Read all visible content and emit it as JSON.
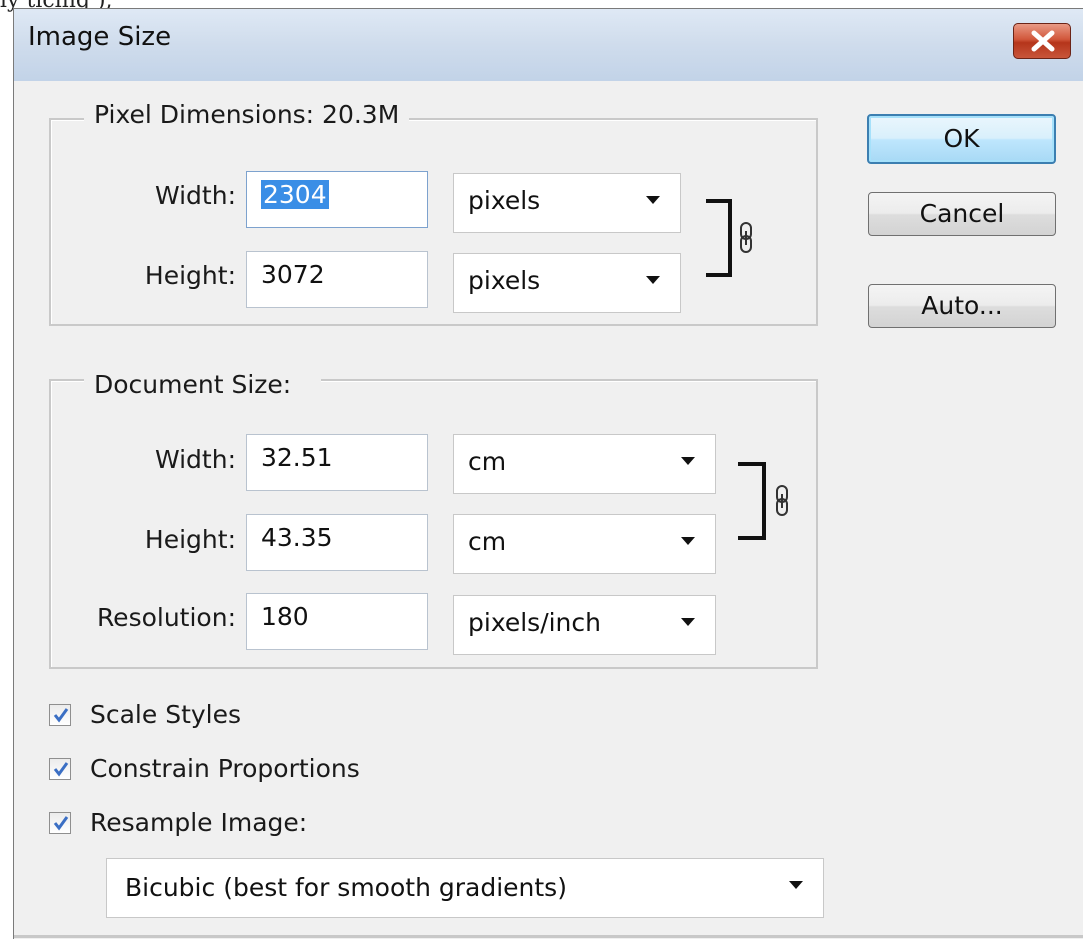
{
  "top_strip_text": "ly ticing ),",
  "window": {
    "title": "Image Size"
  },
  "pixel_dimensions": {
    "legend": "Pixel Dimensions:  20.3M",
    "width_label": "Width:",
    "width_value": "2304",
    "width_unit": "pixels",
    "height_label": "Height:",
    "height_value": "3072",
    "height_unit": "pixels",
    "linked": true
  },
  "document_size": {
    "legend": "Document Size:",
    "width_label": "Width:",
    "width_value": "32.51",
    "width_unit": "cm",
    "height_label": "Height:",
    "height_value": "43.35",
    "height_unit": "cm",
    "resolution_label": "Resolution:",
    "resolution_value": "180",
    "resolution_unit": "pixels/inch",
    "linked": true
  },
  "buttons": {
    "ok": "OK",
    "cancel": "Cancel",
    "auto": "Auto..."
  },
  "options": {
    "scale_styles": {
      "label": "Scale Styles",
      "checked": true
    },
    "constrain_proportions": {
      "label": "Constrain Proportions",
      "checked": true
    },
    "resample_image": {
      "label": "Resample Image:",
      "checked": true
    }
  },
  "resample_method": "Bicubic (best for smooth gradients)",
  "colors": {
    "dialog_bg": "#f0f0f0",
    "titlebar": "#cfdcec",
    "close_red": "#c8553a",
    "default_button_border": "#3c7fb1",
    "selection": "#3a8ee6",
    "check_mark": "#3b6fc4"
  },
  "icons": {
    "close": "close-icon",
    "link_pixel": "chain-link-icon",
    "link_doc": "chain-link-icon",
    "dropdown": "chevron-down-icon",
    "check": "checkmark-icon"
  }
}
